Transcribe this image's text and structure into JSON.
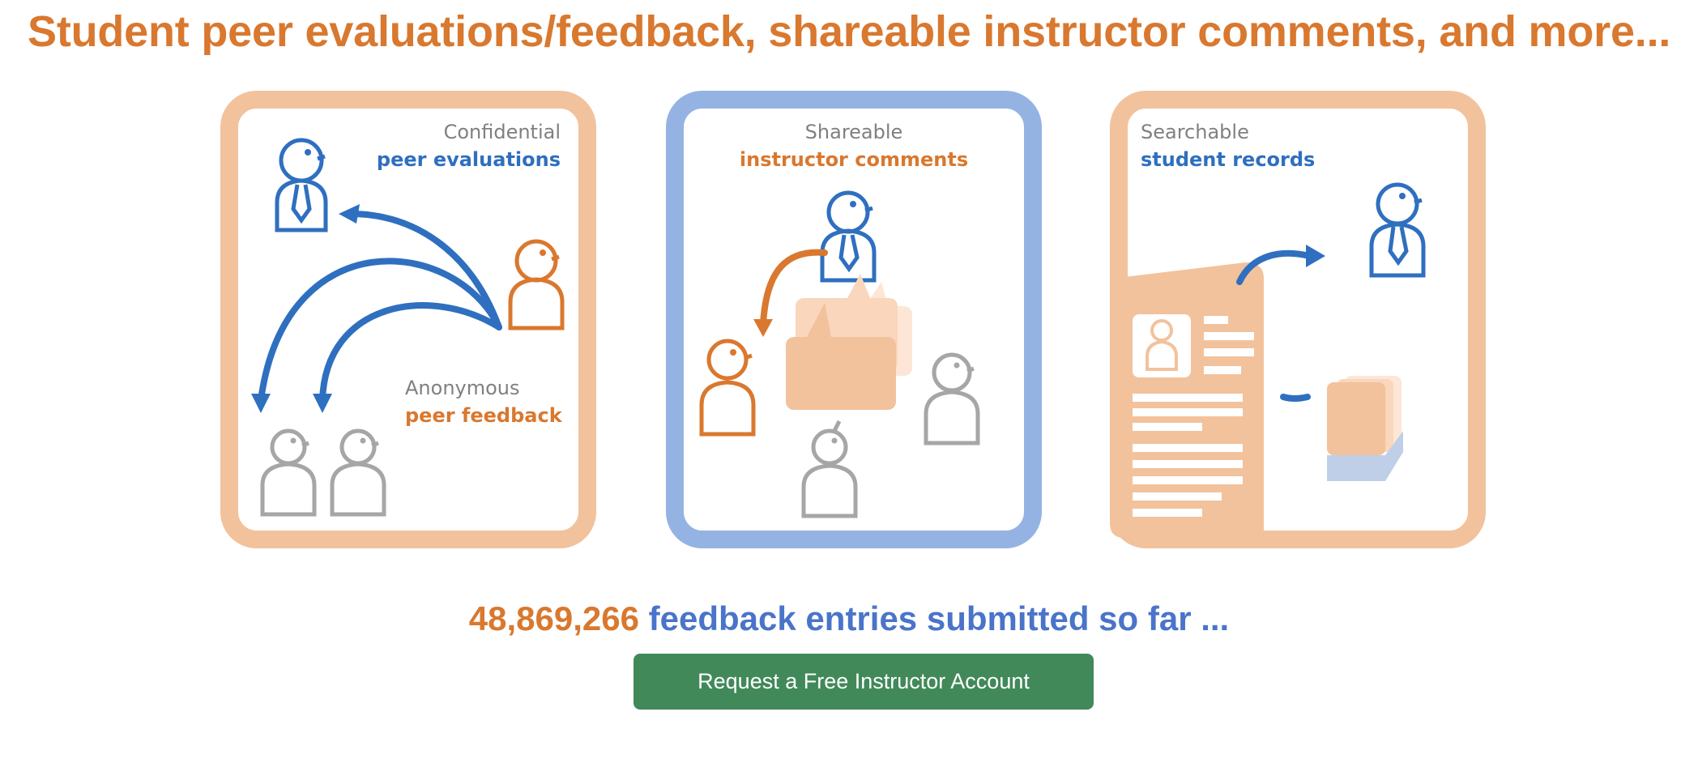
{
  "header": {
    "title": "Student peer evaluations/feedback, shareable instructor comments, and more..."
  },
  "panels": [
    {
      "caption_top_line1": "Confidential",
      "caption_top_line2": "peer evaluations",
      "caption_bottom_line1": "Anonymous",
      "caption_bottom_line2": "peer feedback",
      "frame_color": "#f2c29c"
    },
    {
      "caption_top_line1": "Shareable",
      "caption_top_line2": "instructor comments",
      "frame_color": "#94b3e3"
    },
    {
      "caption_top_line1": "Searchable",
      "caption_top_line2": "student records",
      "frame_color": "#f2c29c"
    }
  ],
  "stats": {
    "count": "48,869,266",
    "label": "feedback entries submitted so far ..."
  },
  "cta": {
    "label": "Request a Free Instructor Account"
  },
  "colors": {
    "orange": "#d9782f",
    "blue": "#2f6fbf",
    "gray": "#a6a6a6",
    "peach": "#f2c29c",
    "light_blue_frame": "#94b3e3",
    "button_green": "#418959"
  }
}
